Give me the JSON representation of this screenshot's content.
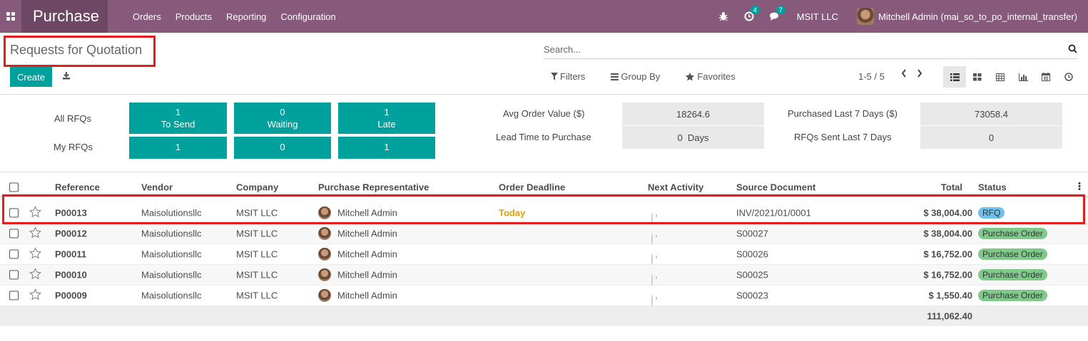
{
  "navbar": {
    "app_name": "Purchase",
    "menu": [
      "Orders",
      "Products",
      "Reporting",
      "Configuration"
    ],
    "activity_badge": "4",
    "message_badge": "7",
    "company": "MSIT LLC",
    "user": "Mitchell Admin (mai_so_to_po_internal_transfer)"
  },
  "control": {
    "breadcrumb": "Requests for Quotation",
    "search_placeholder": "Search...",
    "create_label": "Create",
    "filters_label": "Filters",
    "groupby_label": "Group By",
    "favorites_label": "Favorites",
    "pager": "1-5 / 5"
  },
  "dashboard": {
    "all_rfqs_label": "All RFQs",
    "my_rfqs_label": "My RFQs",
    "tiles": [
      {
        "count": "1",
        "label": "To Send",
        "my": "1"
      },
      {
        "count": "0",
        "label": "Waiting",
        "my": "0"
      },
      {
        "count": "1",
        "label": "Late",
        "my": "1"
      }
    ],
    "avg_order_label": "Avg Order Value ($)",
    "avg_order_value": "18264.6",
    "lead_time_label": "Lead Time to Purchase",
    "lead_time_value": "0  Days",
    "purchased_label": "Purchased Last 7 Days ($)",
    "purchased_value": "73058.4",
    "rfqs_sent_label": "RFQs Sent Last 7 Days",
    "rfqs_sent_value": "0"
  },
  "table": {
    "headers": {
      "reference": "Reference",
      "vendor": "Vendor",
      "company": "Company",
      "rep": "Purchase Representative",
      "deadline": "Order Deadline",
      "activity": "Next Activity",
      "source": "Source Document",
      "total": "Total",
      "status": "Status"
    },
    "rows": [
      {
        "reference": "P00013",
        "vendor": "Maisolutionsllc",
        "company": "MSIT LLC",
        "rep": "Mitchell Admin",
        "deadline": "Today",
        "source": "INV/2021/01/0001",
        "total": "$ 38,004.00",
        "status": "RFQ"
      },
      {
        "reference": "P00012",
        "vendor": "Maisolutionsllc",
        "company": "MSIT LLC",
        "rep": "Mitchell Admin",
        "deadline": "",
        "source": "S00027",
        "total": "$ 38,004.00",
        "status": "Purchase Order"
      },
      {
        "reference": "P00011",
        "vendor": "Maisolutionsllc",
        "company": "MSIT LLC",
        "rep": "Mitchell Admin",
        "deadline": "",
        "source": "S00026",
        "total": "$ 16,752.00",
        "status": "Purchase Order"
      },
      {
        "reference": "P00010",
        "vendor": "Maisolutionsllc",
        "company": "MSIT LLC",
        "rep": "Mitchell Admin",
        "deadline": "",
        "source": "S00025",
        "total": "$ 16,752.00",
        "status": "Purchase Order"
      },
      {
        "reference": "P00009",
        "vendor": "Maisolutionsllc",
        "company": "MSIT LLC",
        "rep": "Mitchell Admin",
        "deadline": "",
        "source": "S00023",
        "total": "$ 1,550.40",
        "status": "Purchase Order"
      }
    ],
    "grand_total": "111,062.40"
  },
  "colors": {
    "navbar": "#875a7b",
    "accent": "#00a09d",
    "highlight": "#e41c1c",
    "status_rfq": "#6cc1ed",
    "status_po": "#7fca8b",
    "deadline_today": "#e0a000"
  }
}
